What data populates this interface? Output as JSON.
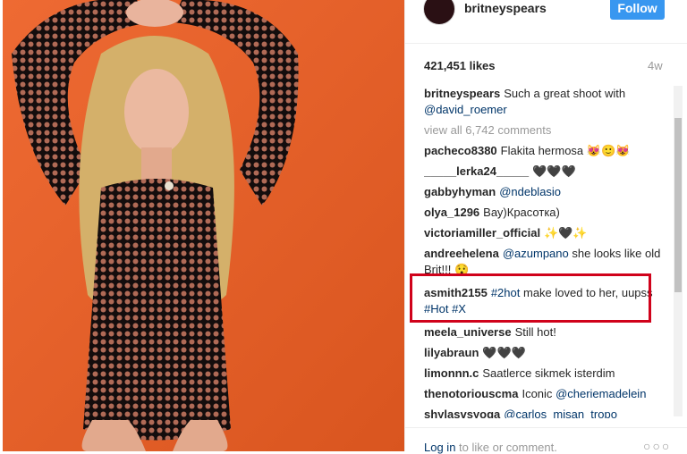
{
  "post": {
    "username": "britneyspears",
    "follow_label": "Follow",
    "likes": "421,451 likes",
    "age": "4w"
  },
  "caption": {
    "user": "britneyspears",
    "text": "Such a great shoot with",
    "tag": "@david_roemer"
  },
  "view_all": "view all 6,742 comments",
  "comments": [
    {
      "user": "pacheco8380",
      "text": "Flakita hermosa 😻🙂😻"
    },
    {
      "user": "_____lerka24_____",
      "text": "🖤🖤🖤"
    },
    {
      "user": "gabbyhyman",
      "tag": "@ndeblasio"
    },
    {
      "user": "olya_1296",
      "text": "Вау)Красотка)"
    },
    {
      "user": "victoriamiller_official",
      "text": "✨🖤✨"
    },
    {
      "user": "andreehelena",
      "tag": "@azumpano",
      "text": "she looks like old Brit!!! 😯"
    },
    {
      "user": "asmith2155",
      "tag": "#2hot",
      "text": "make loved to her, uupss",
      "tag2": "#Hot #X"
    },
    {
      "user": "meela_universe",
      "text": "Still hot!"
    },
    {
      "user": "lilyabraun",
      "text": "🖤🖤🖤"
    },
    {
      "user": "limonnn.c",
      "text": "Saatlerce sikmek isterdim"
    },
    {
      "user": "thenotoriouscma",
      "text": "Iconic",
      "tag": "@cheriemadelein"
    },
    {
      "user": "shylasvsyoga",
      "tag": "@carlos_misan_tropo"
    }
  ],
  "footer": {
    "login_link": "Log in",
    "login_rest": "to like or comment.",
    "more": "○○○"
  },
  "colors": {
    "photo_bg": "#e8612b",
    "follow_button": "#3897f0",
    "highlight": "#d0021b",
    "link": "#003569"
  }
}
